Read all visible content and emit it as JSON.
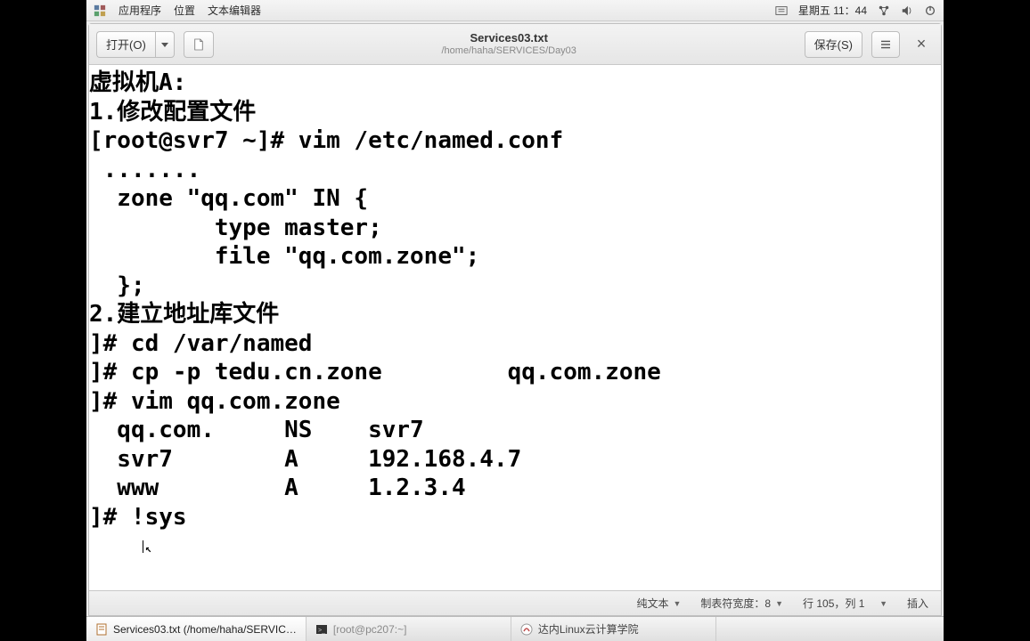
{
  "panel": {
    "apps": "应用程序",
    "places": "位置",
    "title": "文本编辑器",
    "clock": "星期五 11：44"
  },
  "editor": {
    "open": "打开(O)",
    "save": "保存(S)",
    "filename": "Services03.txt",
    "filepath": "/home/haha/SERVICES/Day03",
    "lines": [
      "虚拟机A:",
      "1.修改配置文件",
      "[root@svr7 ~]# vim /etc/named.conf",
      " .......",
      "  zone \"qq.com\" IN {",
      "         type master;",
      "         file \"qq.com.zone\";",
      "  };",
      "2.建立地址库文件",
      "]# cd /var/named",
      "]# cp -p tedu.cn.zone         qq.com.zone",
      "]# vim qq.com.zone",
      "  qq.com.     NS    svr7",
      "  svr7        A     192.168.4.7",
      "  www         A     1.2.3.4",
      "]# !sys"
    ]
  },
  "status": {
    "lang": "纯文本",
    "tab": "制表符宽度：8",
    "pos": "行 105，列 1",
    "mode": "插入"
  },
  "taskbar": {
    "item1": "Services03.txt (/home/haha/SERVIC…",
    "item2": "[root@pc207:~]",
    "item3": "达内Linux云计算学院"
  }
}
